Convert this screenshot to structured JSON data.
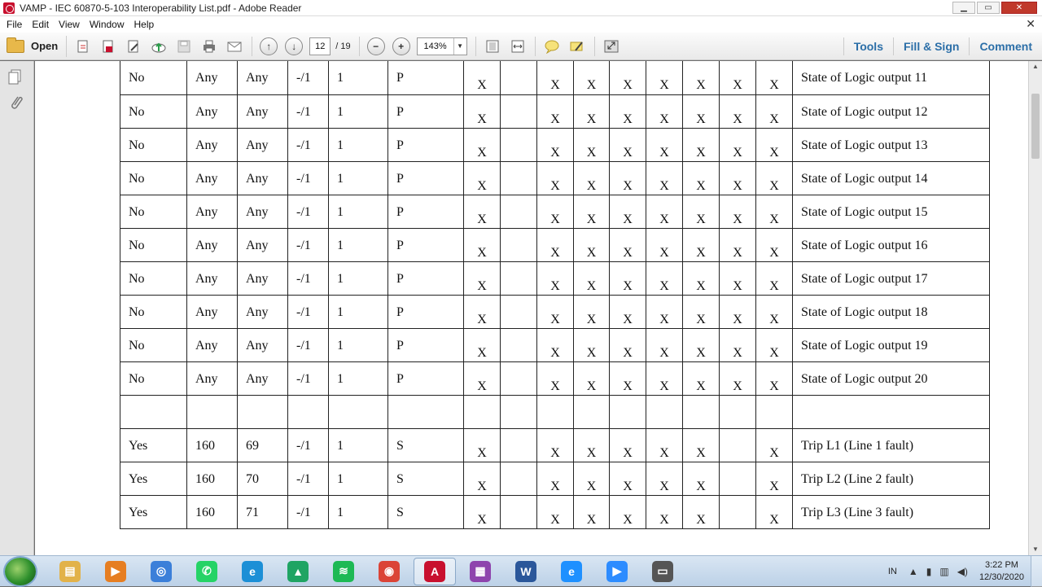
{
  "window": {
    "title": "VAMP - IEC 60870-5-103 Interoperability List.pdf - Adobe Reader",
    "minimize": "▁",
    "maximize": "▭",
    "close": "✕"
  },
  "menu": [
    "File",
    "Edit",
    "View",
    "Window",
    "Help"
  ],
  "menu_close": "✕",
  "toolbar": {
    "open_label": "Open",
    "page_current": "12",
    "page_total": "/ 19",
    "zoom": "143%",
    "tabs": [
      "Tools",
      "Fill & Sign",
      "Comment"
    ]
  },
  "table": {
    "rows": [
      {
        "c1": "No",
        "c2": "Any",
        "c3": "Any",
        "c4": "-/1",
        "c5": "1",
        "c6": "P",
        "x": [
          "X",
          "",
          "X",
          "X",
          "X",
          "X",
          "X",
          "X",
          "X"
        ],
        "desc": "State of Logic output 11"
      },
      {
        "c1": "No",
        "c2": "Any",
        "c3": "Any",
        "c4": "-/1",
        "c5": "1",
        "c6": "P",
        "x": [
          "X",
          "",
          "X",
          "X",
          "X",
          "X",
          "X",
          "X",
          "X"
        ],
        "desc": "State of Logic output 12"
      },
      {
        "c1": "No",
        "c2": "Any",
        "c3": "Any",
        "c4": "-/1",
        "c5": "1",
        "c6": "P",
        "x": [
          "X",
          "",
          "X",
          "X",
          "X",
          "X",
          "X",
          "X",
          "X"
        ],
        "desc": "State of Logic output 13"
      },
      {
        "c1": "No",
        "c2": "Any",
        "c3": "Any",
        "c4": "-/1",
        "c5": "1",
        "c6": "P",
        "x": [
          "X",
          "",
          "X",
          "X",
          "X",
          "X",
          "X",
          "X",
          "X"
        ],
        "desc": "State of Logic output 14"
      },
      {
        "c1": "No",
        "c2": "Any",
        "c3": "Any",
        "c4": "-/1",
        "c5": "1",
        "c6": "P",
        "x": [
          "X",
          "",
          "X",
          "X",
          "X",
          "X",
          "X",
          "X",
          "X"
        ],
        "desc": "State of Logic output 15"
      },
      {
        "c1": "No",
        "c2": "Any",
        "c3": "Any",
        "c4": "-/1",
        "c5": "1",
        "c6": "P",
        "x": [
          "X",
          "",
          "X",
          "X",
          "X",
          "X",
          "X",
          "X",
          "X"
        ],
        "desc": "State of Logic output 16"
      },
      {
        "c1": "No",
        "c2": "Any",
        "c3": "Any",
        "c4": "-/1",
        "c5": "1",
        "c6": "P",
        "x": [
          "X",
          "",
          "X",
          "X",
          "X",
          "X",
          "X",
          "X",
          "X"
        ],
        "desc": "State of Logic output 17"
      },
      {
        "c1": "No",
        "c2": "Any",
        "c3": "Any",
        "c4": "-/1",
        "c5": "1",
        "c6": "P",
        "x": [
          "X",
          "",
          "X",
          "X",
          "X",
          "X",
          "X",
          "X",
          "X"
        ],
        "desc": "State of Logic output 18"
      },
      {
        "c1": "No",
        "c2": "Any",
        "c3": "Any",
        "c4": "-/1",
        "c5": "1",
        "c6": "P",
        "x": [
          "X",
          "",
          "X",
          "X",
          "X",
          "X",
          "X",
          "X",
          "X"
        ],
        "desc": "State of Logic output 19"
      },
      {
        "c1": "No",
        "c2": "Any",
        "c3": "Any",
        "c4": "-/1",
        "c5": "1",
        "c6": "P",
        "x": [
          "X",
          "",
          "X",
          "X",
          "X",
          "X",
          "X",
          "X",
          "X"
        ],
        "desc": "State of Logic output 20"
      },
      {
        "c1": "",
        "c2": "",
        "c3": "",
        "c4": "",
        "c5": "",
        "c6": "",
        "x": [
          "",
          "",
          "",
          "",
          "",
          "",
          "",
          "",
          ""
        ],
        "desc": ""
      },
      {
        "c1": "Yes",
        "c2": "160",
        "c3": "69",
        "c4": "-/1",
        "c5": "1",
        "c6": "S",
        "x": [
          "X",
          "",
          "X",
          "X",
          "X",
          "X",
          "X",
          "",
          "X"
        ],
        "desc": "Trip L1 (Line 1 fault)"
      },
      {
        "c1": "Yes",
        "c2": "160",
        "c3": "70",
        "c4": "-/1",
        "c5": "1",
        "c6": "S",
        "x": [
          "X",
          "",
          "X",
          "X",
          "X",
          "X",
          "X",
          "",
          "X"
        ],
        "desc": "Trip L2 (Line 2 fault)"
      },
      {
        "c1": "Yes",
        "c2": "160",
        "c3": "71",
        "c4": "-/1",
        "c5": "1",
        "c6": "S",
        "x": [
          "X",
          "",
          "X",
          "X",
          "X",
          "X",
          "X",
          "",
          "X"
        ],
        "desc": "Trip L3 (Line 3 fault)"
      }
    ]
  },
  "taskbar": {
    "apps": [
      {
        "name": "explorer",
        "color": "#e2b24a",
        "glyph": "▤"
      },
      {
        "name": "media-player",
        "color": "#e67e22",
        "glyph": "▶"
      },
      {
        "name": "chrome-dev",
        "color": "#3b7fd9",
        "glyph": "◎"
      },
      {
        "name": "whatsapp",
        "color": "#25d366",
        "glyph": "✆"
      },
      {
        "name": "edge",
        "color": "#1c8fd6",
        "glyph": "e"
      },
      {
        "name": "drive",
        "color": "#1fa463",
        "glyph": "▲"
      },
      {
        "name": "spotify",
        "color": "#1db954",
        "glyph": "≋"
      },
      {
        "name": "chrome",
        "color": "#db4437",
        "glyph": "◉"
      },
      {
        "name": "adobe-reader",
        "color": "#c8102e",
        "glyph": "A"
      },
      {
        "name": "winrar",
        "color": "#8e44ad",
        "glyph": "▦"
      },
      {
        "name": "word",
        "color": "#2b579a",
        "glyph": "W"
      },
      {
        "name": "internet-explorer",
        "color": "#1e90ff",
        "glyph": "e"
      },
      {
        "name": "zoom",
        "color": "#2d8cff",
        "glyph": "▶"
      },
      {
        "name": "display",
        "color": "#555",
        "glyph": "▭"
      }
    ],
    "lang": "IN",
    "time": "3:22 PM",
    "date": "12/30/2020"
  }
}
